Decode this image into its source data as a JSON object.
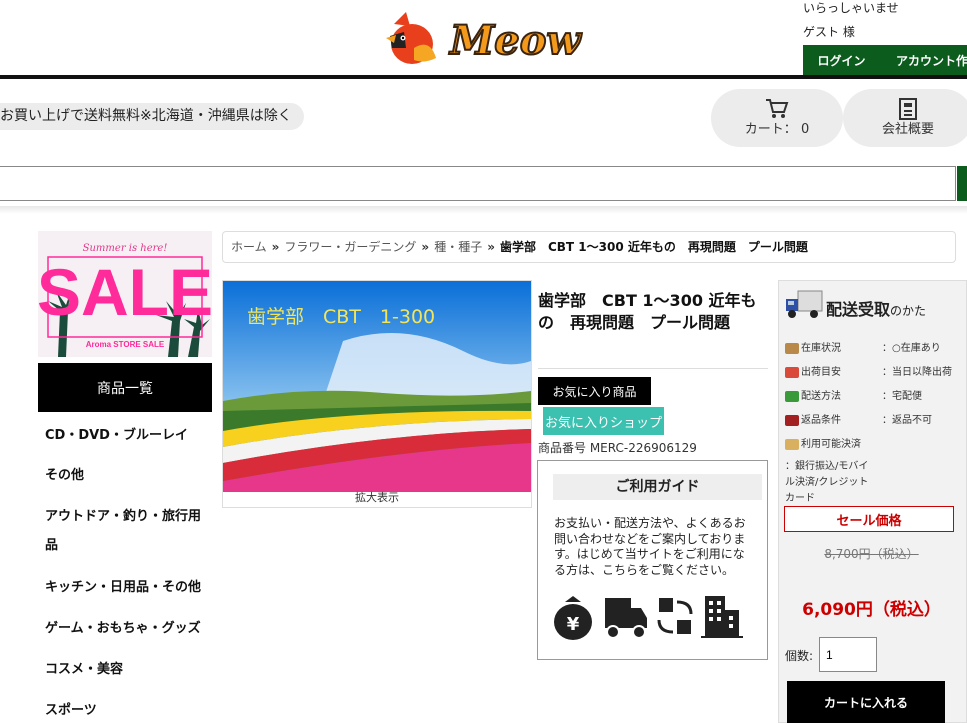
{
  "header": {
    "logo_text": "Meow",
    "welcome": "いらっしゃいませ",
    "guest": "ゲスト 様",
    "login_label": "ログイン",
    "account_label": "アカウント作成",
    "notice": "お買い上げで送料無料※北海道・沖縄県は除く",
    "cart_label": "カート：",
    "cart_count": "0",
    "company_label": "会社概要",
    "search_placeholder": ""
  },
  "sidebar": {
    "banner": {
      "top": "Summer is here!",
      "sale": "SALE",
      "bottom": "Aroma STORE SALE"
    },
    "menu_title": "商品一覧",
    "items": [
      {
        "label": "CD・DVD・ブルーレイ"
      },
      {
        "label": "その他"
      },
      {
        "label": "アウトドア・釣り・旅行用品"
      },
      {
        "label": "キッチン・日用品・その他"
      },
      {
        "label": "ゲーム・おもちゃ・グッズ"
      },
      {
        "label": "コスメ・美容"
      },
      {
        "label": "スポーツ"
      }
    ]
  },
  "breadcrumb": {
    "items": [
      "ホーム",
      "フラワー・ガーデニング",
      "種・種子"
    ],
    "separator": "»",
    "current": "歯学部　CBT 1～300 近年もの　再現問題　プール問題"
  },
  "product": {
    "image_text": "歯学部　CBT　1-300",
    "zoom_label": "拡大表示",
    "title": "歯学部　CBT 1～300 近年もの　再現問題　プール問題",
    "fav_item_label": "お気に入り商品",
    "fav_shop_label": "お気に入りショップ",
    "item_number": "商品番号 MERC-226906129"
  },
  "guide": {
    "title": "ご利用ガイド",
    "text": "お支払い・配送方法や、よくあるお問い合わせなどをご案内しております。はじめて当サイトをご利用になる方は、こちらをご覧ください。",
    "icons": [
      "money-bag-icon",
      "delivery-truck-icon",
      "exchange-icon",
      "building-icon"
    ]
  },
  "delivery": {
    "title": "配送受取",
    "title_small": "のかた",
    "rows": [
      {
        "label": "在庫状況",
        "value": "：○在庫あり"
      },
      {
        "label": "出荷目安",
        "value": "：当日以降出荷"
      },
      {
        "label": "配送方法",
        "value": "：宅配便"
      },
      {
        "label": "返品条件",
        "value": "：返品不可"
      },
      {
        "label": "利用可能決済",
        "value": ""
      }
    ],
    "payment": "：銀行振込/モバイル決済/クレジットカード",
    "sale_label": "セール価格",
    "original_price": "8,700円（税込）",
    "sale_price": "6,090円（税込）",
    "qty_label": "個数:",
    "qty_value": "1",
    "add_to_cart": "カートに入れる"
  },
  "colors": {
    "accent_green": "#0b5c1d",
    "sale_red": "#cc0000",
    "teal": "#3cc1b0"
  }
}
